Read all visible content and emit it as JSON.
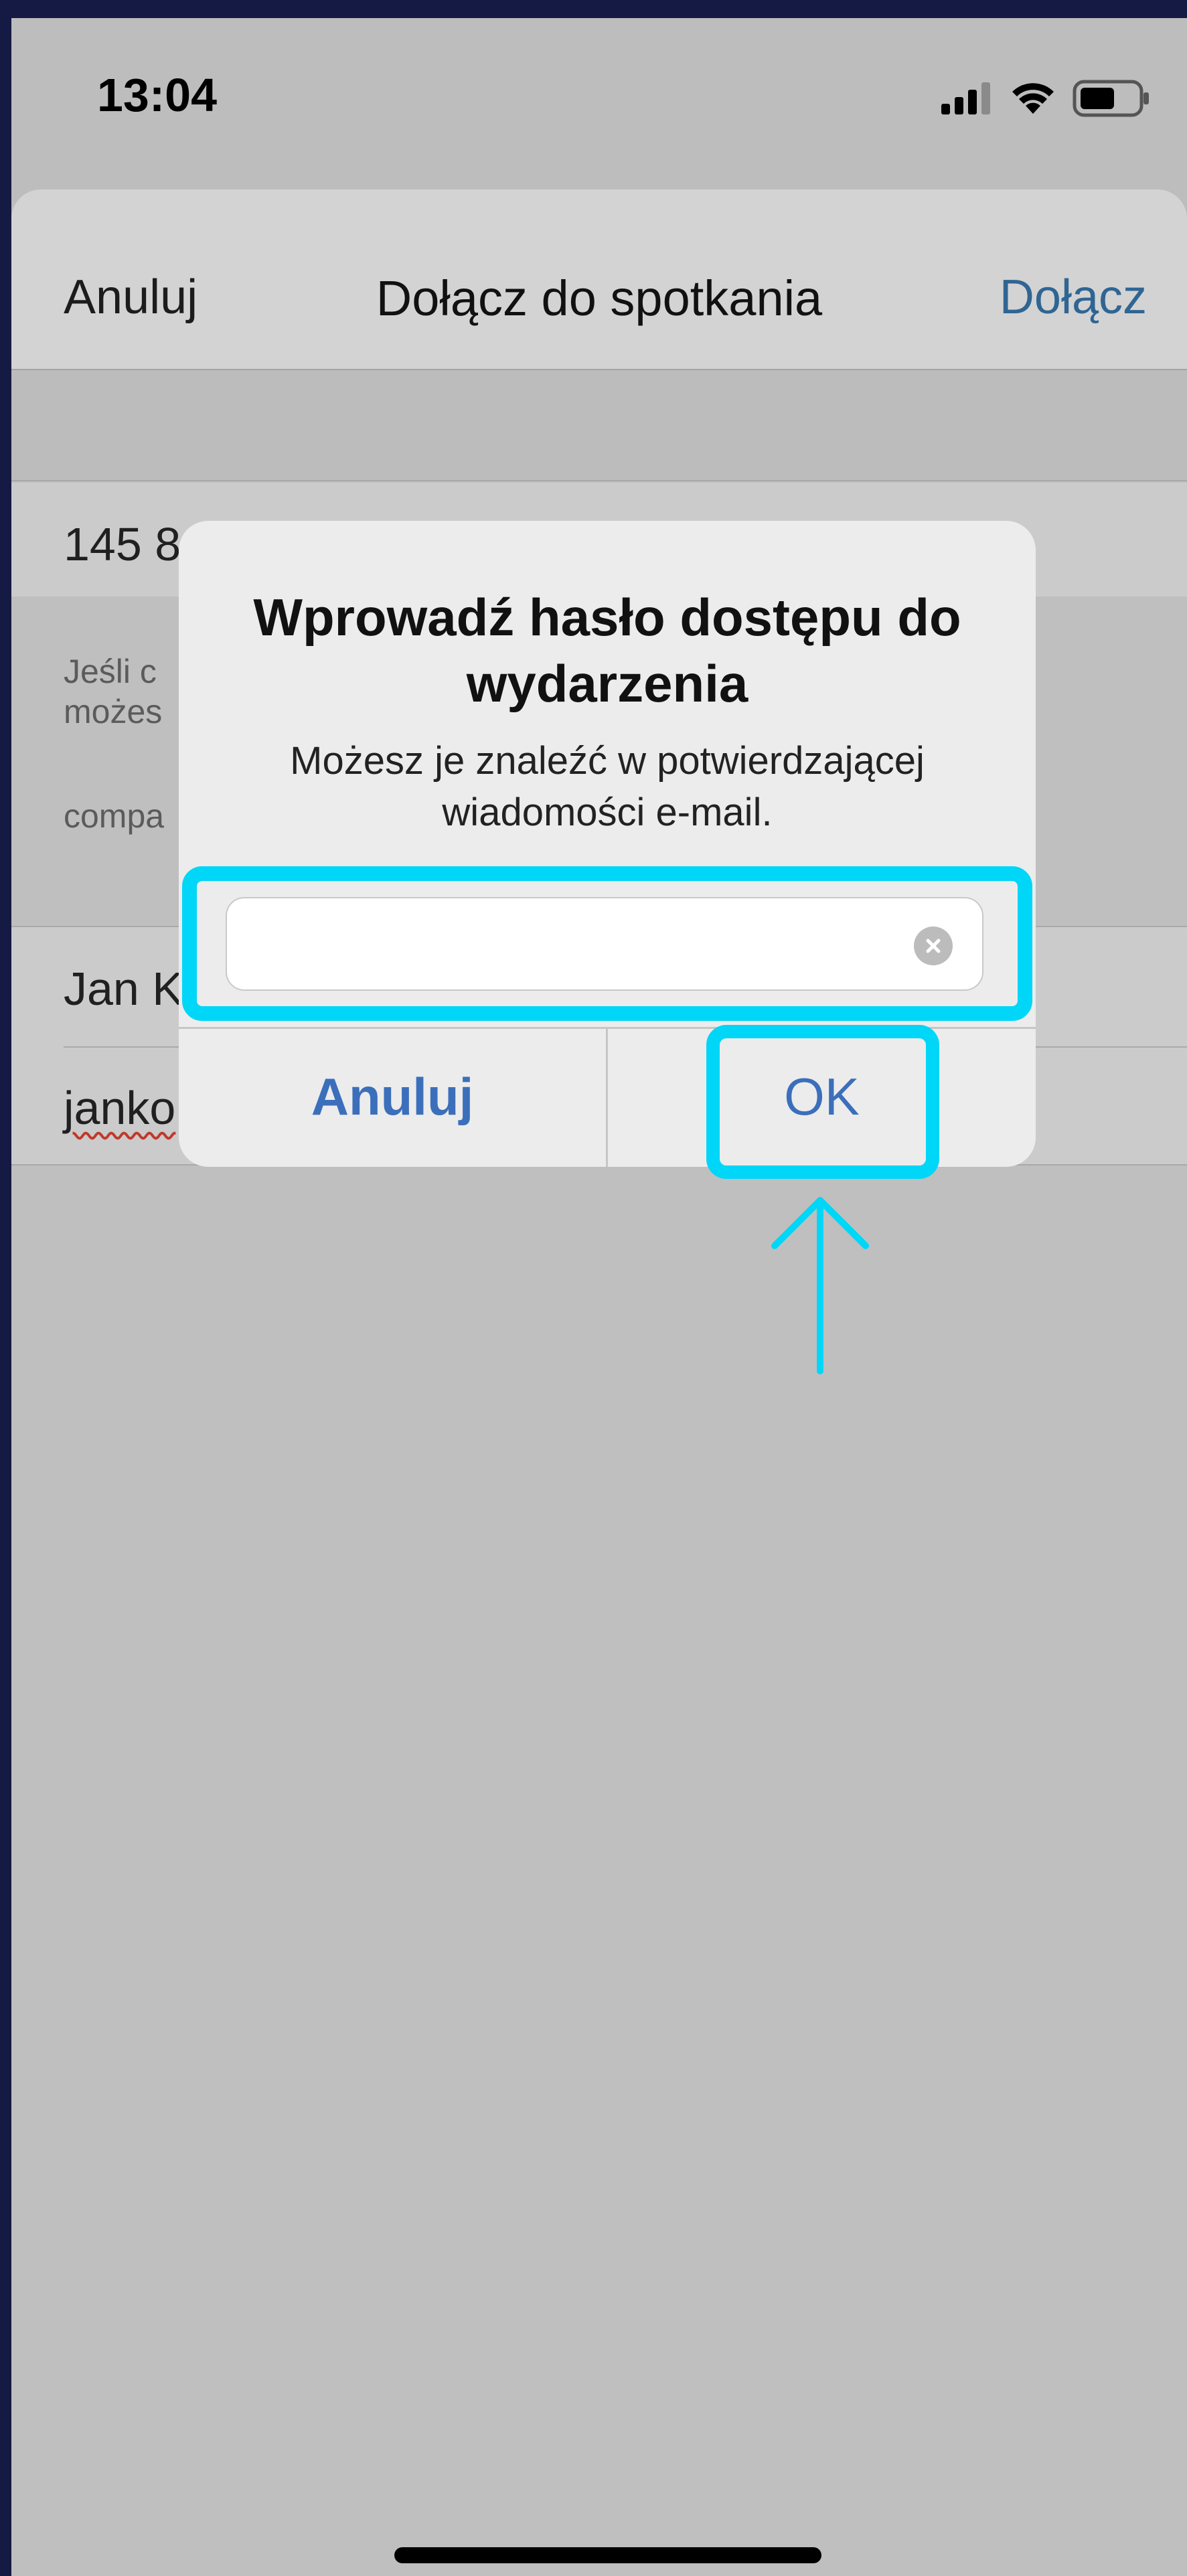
{
  "status_bar": {
    "time": "13:04",
    "icons": [
      "cellular-signal-icon",
      "wifi-icon",
      "battery-icon"
    ]
  },
  "navbar": {
    "cancel_label": "Anuluj",
    "title": "Dołącz do spotkania",
    "join_label": "Dołącz"
  },
  "form": {
    "meeting_number": "145 8",
    "note_line1": "Jeśli c",
    "note_line2": "możes",
    "note_line3": "compa",
    "name": "Jan K",
    "email": "janko"
  },
  "alert": {
    "title": "Wprowadź hasło dostępu do wydarzenia",
    "message": "Możesz je znaleźć w potwierdzającej wiadomości e-mail.",
    "input_value": "",
    "cancel_label": "Anuluj",
    "ok_label": "OK"
  },
  "colors": {
    "highlight": "#00d6f7",
    "link_blue": "#3b6fbb",
    "nav_join_blue": "#2f6593",
    "outer_background": "#141a44"
  }
}
